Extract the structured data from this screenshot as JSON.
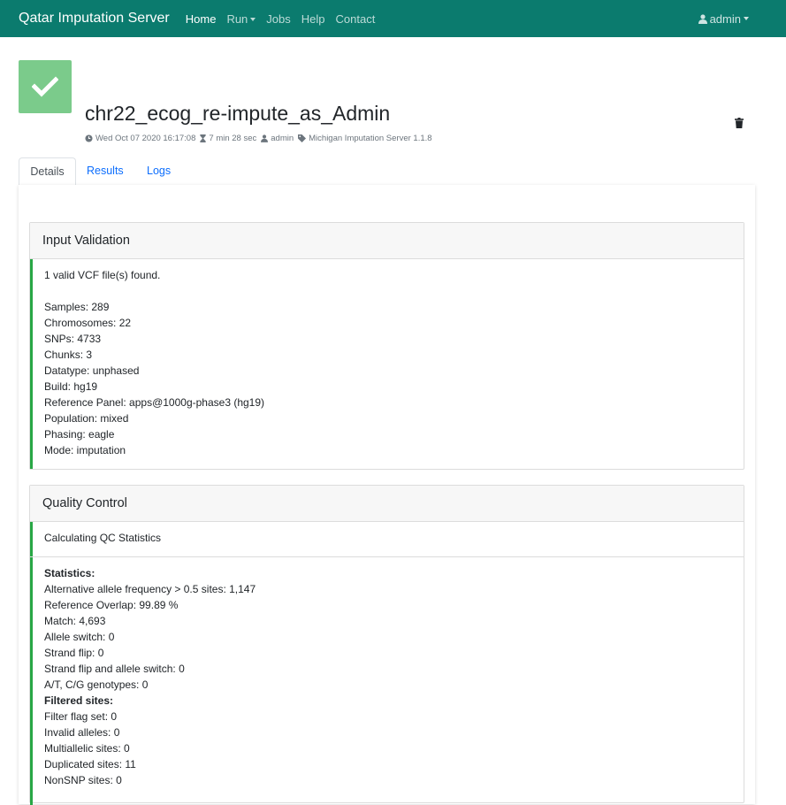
{
  "nav": {
    "brand": "Qatar Imputation Server",
    "items": [
      {
        "label": "Home",
        "active": true,
        "dropdown": false
      },
      {
        "label": "Run",
        "active": false,
        "dropdown": true
      },
      {
        "label": "Jobs",
        "active": false,
        "dropdown": false
      },
      {
        "label": "Help",
        "active": false,
        "dropdown": false
      },
      {
        "label": "Contact",
        "active": false,
        "dropdown": false
      }
    ],
    "user": "admin"
  },
  "job": {
    "title": "chr22_ecog_re-impute_as_Admin",
    "date": "Wed Oct 07 2020 16:17:08",
    "duration": "7 min 28 sec",
    "user": "admin",
    "app": "Michigan Imputation Server 1.1.8",
    "status": "success"
  },
  "tabs": [
    "Details",
    "Results",
    "Logs"
  ],
  "input_validation": {
    "title": "Input Validation",
    "found": "1 valid VCF file(s) found.",
    "lines": [
      "Samples: 289",
      "Chromosomes: 22",
      "SNPs: 4733",
      "Chunks: 3",
      "Datatype: unphased",
      "Build: hg19",
      "Reference Panel: apps@1000g-phase3 (hg19)",
      "Population: mixed",
      "Phasing: eagle",
      "Mode: imputation"
    ]
  },
  "quality_control": {
    "title": "Quality Control",
    "calculating": "Calculating QC Statistics",
    "statistics_heading": "Statistics:",
    "statistics": [
      "Alternative allele frequency > 0.5 sites: 1,147",
      "Reference Overlap: 99.89 %",
      "Match: 4,693",
      "Allele switch: 0",
      "Strand flip: 0",
      "Strand flip and allele switch: 0",
      "A/T, C/G genotypes: 0"
    ],
    "filtered_heading": "Filtered sites:",
    "filtered": [
      "Filter flag set: 0",
      "Invalid alleles: 0",
      "Multiallelic sites: 0",
      "Duplicated sites: 11",
      "NonSNP sites: 0"
    ]
  },
  "colors": {
    "navbar": "#0b7b6e",
    "success": "#28a745",
    "status_box": "#7bcb8b",
    "link": "#0d6efd"
  }
}
